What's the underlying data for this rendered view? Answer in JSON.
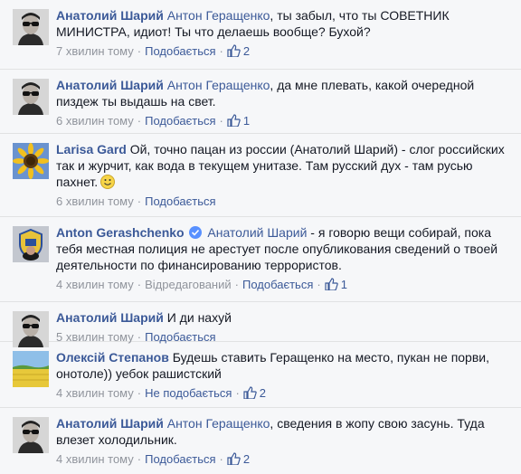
{
  "comments": [
    {
      "author": "Анатолий Шарий",
      "mention": "Антон Геращенко",
      "text": ", ты забыл, что ты СОВЕТНИК МИНИСТРА, идиот! Ты что делаешь вообще? Бухой?",
      "time": "7 хвилин тому",
      "action": "Подобається",
      "likes": "2"
    },
    {
      "author": "Анатолий Шарий",
      "mention": "Антон Геращенко",
      "text": ", да мне плевать, какой очередной пиздеж ты выдашь на свет.",
      "time": "6 хвилин тому",
      "action": "Подобається",
      "likes": "1"
    },
    {
      "author": "Larisa Gard",
      "text": "Ой, точно пацан из россии (Анатолий Шарий) - слог российских так и журчит, как вода в текущем унитазе. Там русский дух - там русью пахнет.",
      "time": "6 хвилин тому",
      "action": "Подобається"
    },
    {
      "author": "Anton Gerashchenko",
      "mention": "Анатолий Шарий",
      "text": " - я говорю вещи собирай, пока тебя местная полиция не арестует после опубликования сведений о твоей деятельности по финансированию террористов.",
      "time": "4 хвилин тому",
      "edited": "Відредагований",
      "action": "Подобається",
      "likes": "1"
    },
    {
      "author": "Анатолий Шарий",
      "text": "И ди нахуй",
      "time": "5 хвилин тому",
      "action": "Подобається"
    },
    {
      "author": "Олексій Степанов",
      "text": "Будешь ставить Геращенко на место, пукан не порви, онотоле)) уебок рашистский",
      "time": "4 хвилин тому",
      "action": "Не подобається",
      "likes": "2"
    },
    {
      "author": "Анатолий Шарий",
      "mention": "Антон Геращенко",
      "text": ", сведения в жопу свою засунь. Туда влезет холодильник.",
      "time": "4 хвилин тому",
      "action": "Подобається",
      "likes": "2"
    }
  ],
  "colors": {
    "link": "#3b5998",
    "meta": "#90949c",
    "background": "#f6f7f9"
  }
}
